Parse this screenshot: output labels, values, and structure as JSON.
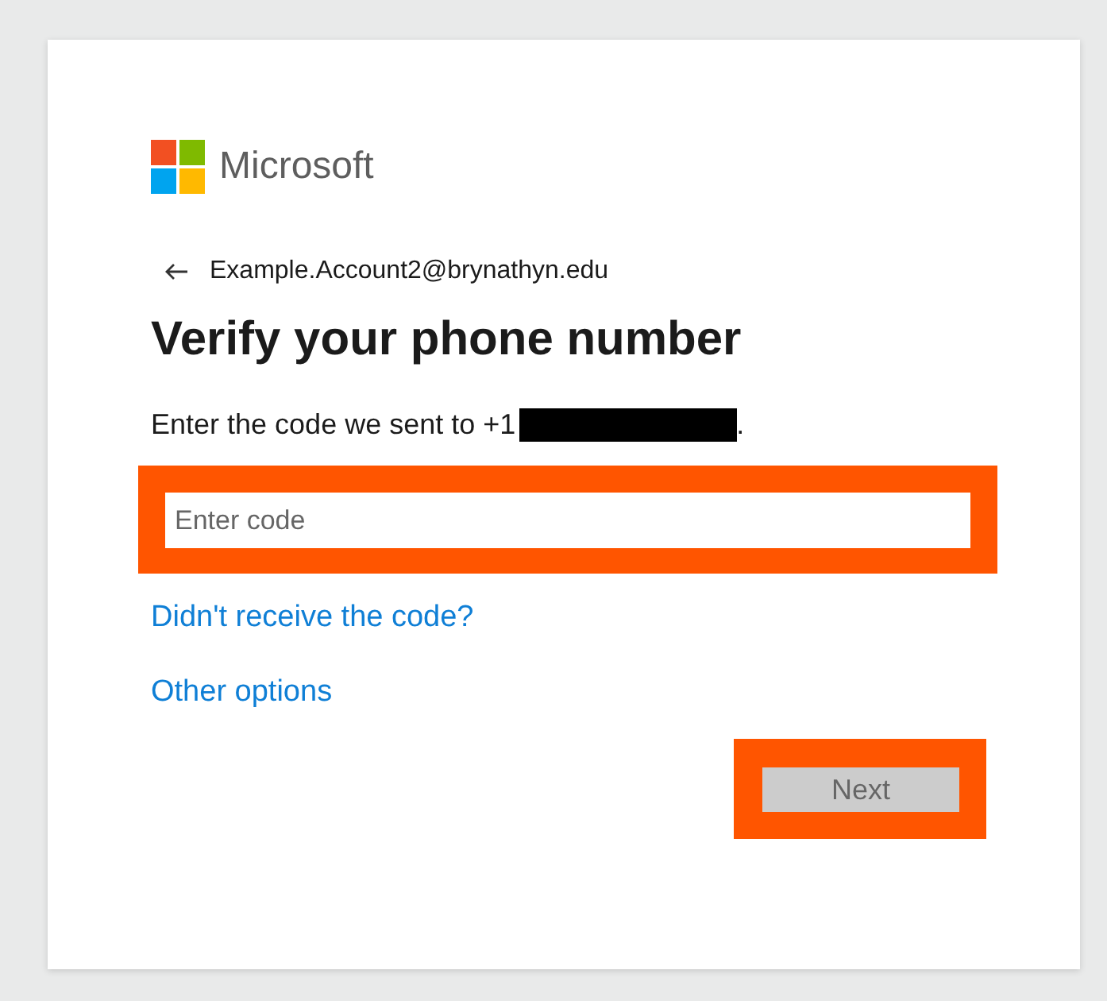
{
  "brand": {
    "name": "Microsoft"
  },
  "account": {
    "email": "Example.Account2@brynathyn.edu"
  },
  "title": "Verify your phone number",
  "instruction": {
    "text": "Enter the code we sent to +1",
    "redacted": true,
    "end": "."
  },
  "code_field": {
    "placeholder": "Enter code",
    "highlighted": true
  },
  "links": [
    "Didn't receive the code?",
    "Other options"
  ],
  "next_button": {
    "label": "Next",
    "disabled": true,
    "highlighted": true
  }
}
